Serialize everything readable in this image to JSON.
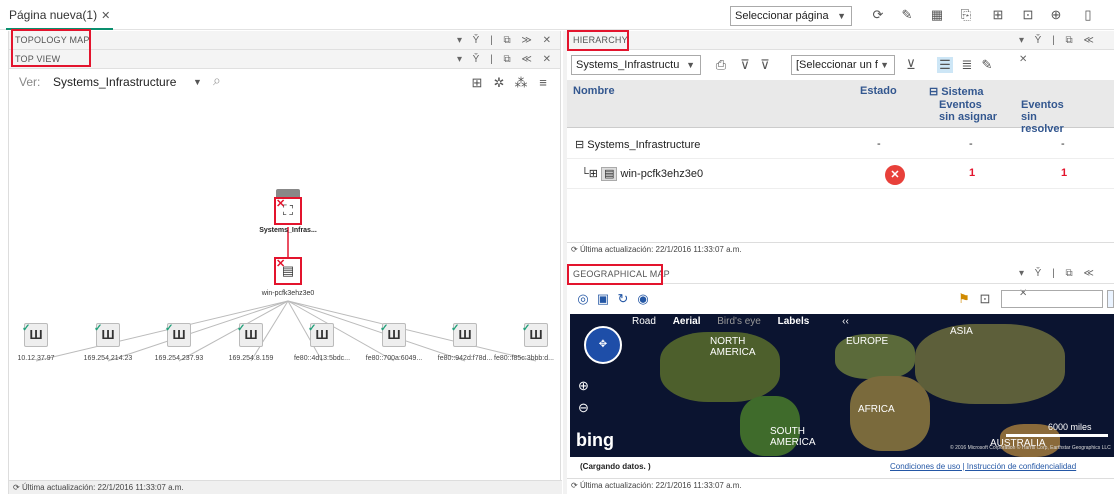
{
  "tab": {
    "label": "Página nueva(1)",
    "close": "✕"
  },
  "page_selector": {
    "label": "Seleccionar página"
  },
  "topology": {
    "header1": "TOPOLOGY MAP",
    "header2": "TOP VIEW",
    "view_label": "Ver:",
    "view_value": "Systems_Infrastructure",
    "root_label": "Systems_Infras...",
    "host_label": "win-pcfk3ehz3e0",
    "leaves": [
      "10.12.37.97",
      "169.254.214.23",
      "169.254.237.93",
      "169.254.8.159",
      "fe80::4d13:5bdc...",
      "fe80::700a:6049...",
      "fe80::942d:f78d...",
      "fe80::f85c:3bbb:d..."
    ],
    "status": "Última actualización: 22/1/2016 11:33:07 a.m."
  },
  "hierarchy": {
    "header": "HIERARCHY",
    "select1": "Systems_Infrastructu",
    "select2": "[Seleccionar un f",
    "columns": {
      "name": "Nombre",
      "estado": "Estado",
      "sistema": "Sistema",
      "sin_asignar": "Eventos sin asignar",
      "sin_resolver": "Eventos sin resolver"
    },
    "rows": [
      {
        "name": "Systems_Infrastructure",
        "estado": "-",
        "asignar": "-",
        "resolver": "-"
      },
      {
        "name": "win-pcfk3ehz3e0",
        "estado": "",
        "asignar": "1",
        "resolver": "1"
      }
    ],
    "status": "Última actualización: 22/1/2016 11:33:07 a.m."
  },
  "geo": {
    "header": "GEOGRAPHICAL MAP",
    "map_tabs": [
      "Road",
      "Aerial",
      "Bird's eye",
      "Labels"
    ],
    "continents": {
      "na": "NORTH AMERICA",
      "eu": "EUROPE",
      "asia": "ASIA",
      "africa": "AFRICA",
      "sa": "SOUTH AMERICA",
      "au": "AUSTRALIA"
    },
    "scale": "6000 miles",
    "copyright": "© 2016 Microsoft Corporation © Harris Corp, Earthstar Geographics LLC Image courtesy of NASA",
    "bing": "bing",
    "loading": "(Cargando datos. )",
    "terms": "Condiciones de uso | Instrucción de confidencialidad",
    "status": "Última actualización: 22/1/2016 11:33:07 a.m."
  },
  "colors": {
    "accent": "#0a8f6e",
    "highlight": "#e3142d",
    "header_link": "#33578f"
  }
}
